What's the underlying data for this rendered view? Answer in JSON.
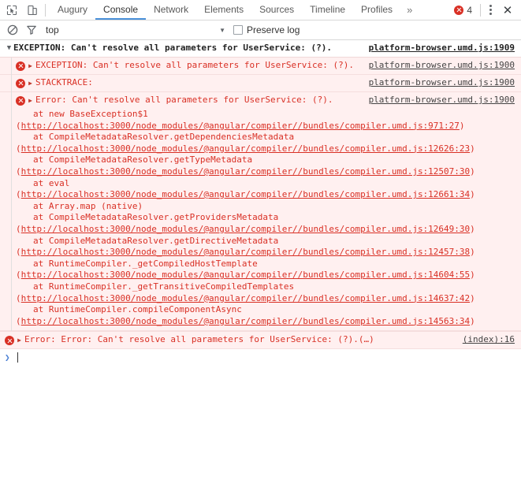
{
  "toolbar": {
    "icons": [
      {
        "name": "inspect-element-icon",
        "glyph": "inspect"
      },
      {
        "name": "device-toolbar-icon",
        "glyph": "device"
      }
    ],
    "tabs": [
      {
        "label": "Augury",
        "active": false
      },
      {
        "label": "Console",
        "active": true
      },
      {
        "label": "Network",
        "active": false
      },
      {
        "label": "Elements",
        "active": false
      },
      {
        "label": "Sources",
        "active": false
      },
      {
        "label": "Timeline",
        "active": false
      },
      {
        "label": "Profiles",
        "active": false
      }
    ],
    "more_label": "»",
    "error_count": "4",
    "menu_label": "⋮",
    "close_label": "✕",
    "error_color": "#d93025",
    "active_tab_color": "#4a90d9"
  },
  "filterbar": {
    "clear_icon": "clear-console-icon",
    "filter_icon": "filter-icon",
    "context_value": "top",
    "context_arrow": "▼",
    "preserve_log_label": "Preserve log",
    "preserve_log_checked": false
  },
  "console": {
    "group": {
      "triangle": "▼",
      "title": "EXCEPTION: Can't resolve all parameters for UserService: (?).",
      "source": "platform-browser.umd.js:1909"
    },
    "messages": [
      {
        "triangle": "▶",
        "text": "EXCEPTION: Can't resolve all parameters for UserService: (?).",
        "source": "platform-browser.umd.js:1900"
      },
      {
        "triangle": "▶",
        "text": "STACKTRACE:",
        "source": "platform-browser.umd.js:1900"
      },
      {
        "triangle": "▶",
        "text": "Error: Can't resolve all parameters for UserService: (?).",
        "source": "platform-browser.umd.js:1900"
      }
    ],
    "stack_frames": [
      {
        "fn": "at new BaseException$1",
        "url": "http://localhost:3000/node_modules/@angular/compiler//bundles/compiler.umd.js:971:27"
      },
      {
        "fn": "at CompileMetadataResolver.getDependenciesMetadata",
        "url": "http://localhost:3000/node_modules/@angular/compiler//bundles/compiler.umd.js:12626:23"
      },
      {
        "fn": "at CompileMetadataResolver.getTypeMetadata",
        "url": "http://localhost:3000/node_modules/@angular/compiler//bundles/compiler.umd.js:12507:30"
      },
      {
        "fn": "at eval",
        "url": "http://localhost:3000/node_modules/@angular/compiler//bundles/compiler.umd.js:12661:34"
      },
      {
        "fn": "at Array.map (native)",
        "url": ""
      },
      {
        "fn": "at CompileMetadataResolver.getProvidersMetadata",
        "url": "http://localhost:3000/node_modules/@angular/compiler//bundles/compiler.umd.js:12649:30"
      },
      {
        "fn": "at CompileMetadataResolver.getDirectiveMetadata",
        "url": "http://localhost:3000/node_modules/@angular/compiler//bundles/compiler.umd.js:12457:38"
      },
      {
        "fn": "at RuntimeCompiler._getCompiledHostTemplate",
        "url": "http://localhost:3000/node_modules/@angular/compiler//bundles/compiler.umd.js:14604:55"
      },
      {
        "fn": "at RuntimeCompiler._getTransitiveCompiledTemplates",
        "url": "http://localhost:3000/node_modules/@angular/compiler//bundles/compiler.umd.js:14637:42"
      },
      {
        "fn": "at RuntimeCompiler.compileComponentAsync",
        "url": "http://localhost:3000/node_modules/@angular/compiler//bundles/compiler.umd.js:14563:34"
      }
    ],
    "last_message": {
      "triangle": "▶",
      "text": "Error: Error: Can't resolve all parameters for UserService: (?).(…)",
      "source": "(index):16"
    },
    "prompt": {
      "arrow": "❯",
      "value": ""
    }
  }
}
